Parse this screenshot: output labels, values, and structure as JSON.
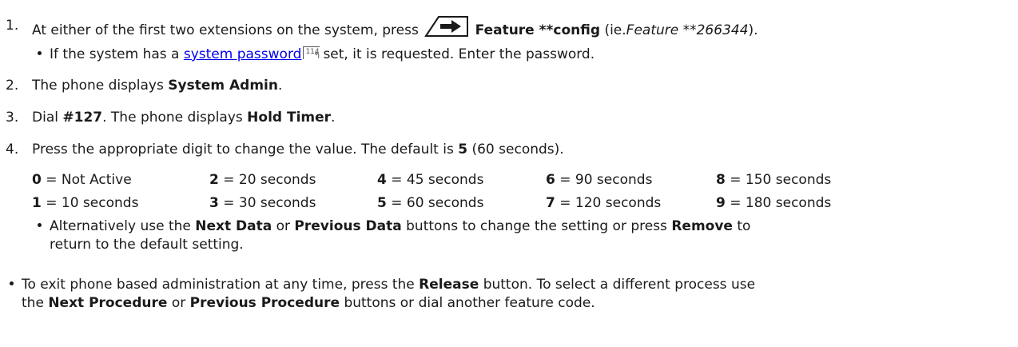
{
  "step1": {
    "number": "1.",
    "text_a": "At either of the first two extensions on the system, press",
    "feature_label": "Feature **config",
    "paren_open": "(ie.",
    "feature_code": "Feature **266344",
    "paren_close": ")."
  },
  "note1": {
    "text_a": "If the system has a",
    "link_text": "system password",
    "page_ref": "114",
    "text_b": "set, it is requested. Enter the password."
  },
  "step2": {
    "number": "2.",
    "text_a": "The phone displays",
    "display": "System Admin",
    "end": "."
  },
  "step3": {
    "number": "3.",
    "text_a": "Dial",
    "code": "#127",
    "text_b": ". The phone displays",
    "display": "Hold Timer",
    "end": "."
  },
  "step4": {
    "number": "4.",
    "text_a": "Press the appropriate digit to change the value. The default is",
    "default_value": "5",
    "text_b": "(60 seconds)."
  },
  "options": [
    {
      "digit": "0",
      "value": "= Not Active"
    },
    {
      "digit": "1",
      "value": "= 10 seconds"
    },
    {
      "digit": "2",
      "value": "= 20 seconds"
    },
    {
      "digit": "3",
      "value": "= 30 seconds"
    },
    {
      "digit": "4",
      "value": "= 45 seconds"
    },
    {
      "digit": "5",
      "value": "= 60 seconds"
    },
    {
      "digit": "6",
      "value": "= 90 seconds"
    },
    {
      "digit": "7",
      "value": "= 120 seconds"
    },
    {
      "digit": "8",
      "value": "= 150 seconds"
    },
    {
      "digit": "9",
      "value": "= 180 seconds"
    }
  ],
  "note4": {
    "line1_a": "Alternatively use the",
    "next_data": "Next Data",
    "or": "or",
    "previous_data": "Previous Data",
    "line1_b": "buttons to change the setting or press",
    "remove": "Remove",
    "line1_c": "to",
    "line2": "return to the default setting."
  },
  "exit_note": {
    "line1_a": "To exit phone based administration at any time, press the",
    "release": "Release",
    "line1_b": "button. To select a different process use",
    "line2_a": "the",
    "next_procedure": "Next Procedure",
    "or": "or",
    "previous_procedure": "Previous Procedure",
    "line2_b": "buttons or dial another feature code."
  },
  "icons": {
    "feature_icon": "feature-button-icon",
    "page_ref_icon": "page-reference-icon"
  },
  "colors": {
    "link": "#0000ee",
    "text": "#1a1a1a"
  }
}
